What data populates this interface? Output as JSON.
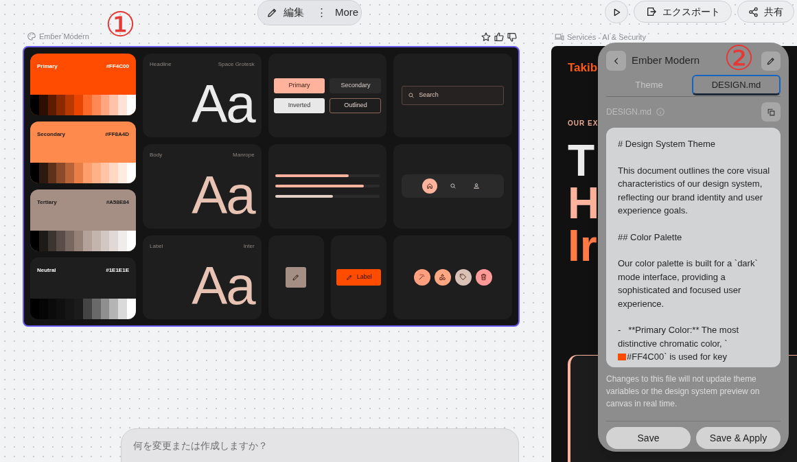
{
  "toolbar": {
    "edit_label": "編集",
    "more_glyph": "⋮",
    "more_label": "More"
  },
  "top_actions": {
    "export_label": "エクスポート",
    "share_label": "共有"
  },
  "annotations": [
    "①",
    "②"
  ],
  "theme_frame": {
    "title": "Ember Modern",
    "swatches": [
      {
        "name": "Primary",
        "hex": "#FF4C00",
        "color": "#ff4c00"
      },
      {
        "name": "Secondary",
        "hex": "#FF8A4D",
        "color": "#ff8a4d"
      },
      {
        "name": "Tertiary",
        "hex": "#A58E84",
        "color": "#a58e84"
      },
      {
        "name": "Neutral",
        "hex": "#1E1E1E",
        "color": "#1e1e1e"
      }
    ],
    "type_styles": [
      {
        "role": "Headline",
        "font": "Space Grotesk",
        "sample": "Aa",
        "color": "#ebebeb"
      },
      {
        "role": "Body",
        "font": "Manrope",
        "sample": "Aa",
        "color": "#e8c2b2"
      },
      {
        "role": "Label",
        "font": "Inter",
        "sample": "Aa",
        "color": "#e8c2b2"
      }
    ],
    "buttons": [
      {
        "label": "Primary",
        "kind": "filled"
      },
      {
        "label": "Secondary",
        "kind": "tonal"
      },
      {
        "label": "Inverted",
        "kind": "inverted"
      },
      {
        "label": "Outlined",
        "kind": "outlined"
      }
    ],
    "search": {
      "placeholder": "Search"
    },
    "progress_bars": [
      {
        "level": 0.7,
        "color": "#ffb39c"
      },
      {
        "level": 0.85,
        "color": "#ffb39c"
      },
      {
        "level": 0.55,
        "color": "#e3cfc6"
      }
    ],
    "nav_items": [
      {
        "kind": "home",
        "selected": true
      },
      {
        "kind": "search",
        "selected": false
      },
      {
        "kind": "person",
        "selected": false
      }
    ],
    "label_button": {
      "label": "Label"
    },
    "fabs": [
      {
        "kind": "wand",
        "color": "#ff9f7e"
      },
      {
        "kind": "shapes",
        "color": "#ffa783"
      },
      {
        "kind": "tag",
        "color": "#d9c1b6"
      },
      {
        "kind": "trash",
        "color": "#ff9a98"
      }
    ]
  },
  "services_frame": {
    "title": "Services - AI & Security",
    "brand": "Takib",
    "eyebrow": "OUR EX",
    "headline": [
      "T",
      "H",
      "Ir"
    ]
  },
  "panel": {
    "title": "Ember Modern",
    "tabs": [
      {
        "label": "Theme",
        "selected": false
      },
      {
        "label": "DESIGN.md",
        "selected": true
      }
    ],
    "file_label": "DESIGN.md",
    "document": [
      "# Design System Theme",
      "This document outlines the core visual characteristics of our design system, reflecting our brand identity and user experience goals.",
      "## Color Palette",
      "Our color palette is built for a `dark` mode interface, providing a sophisticated and focused user experience.",
      "-   **Primary Color:** The most distinctive chromatic color, `"
    ],
    "document_tail": {
      "color": "#ff4c00",
      "text": "#FF4C00` is used for key"
    },
    "note": "Changes to this file will not update theme variables or the design system preview on canvas in real time.",
    "buttons": [
      "Save",
      "Save & Apply"
    ]
  },
  "chat": {
    "placeholder": "何を変更または作成しますか？"
  }
}
